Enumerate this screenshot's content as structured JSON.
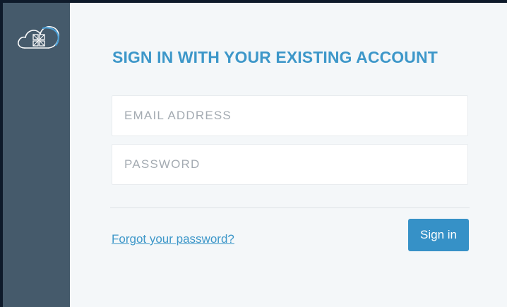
{
  "sidebar": {
    "logo_icon": "cloud-grid-logo-icon"
  },
  "form": {
    "title": "SIGN IN WITH YOUR EXISTING ACCOUNT",
    "email": {
      "placeholder": "EMAIL ADDRESS",
      "value": ""
    },
    "password": {
      "placeholder": "PASSWORD",
      "value": ""
    },
    "forgot_label": "Forgot your password?",
    "signin_label": "Sign in"
  },
  "colors": {
    "sidebar": "#455a6b",
    "accent": "#3d97c9",
    "button": "#3691c7",
    "background": "#f4f7f9"
  }
}
